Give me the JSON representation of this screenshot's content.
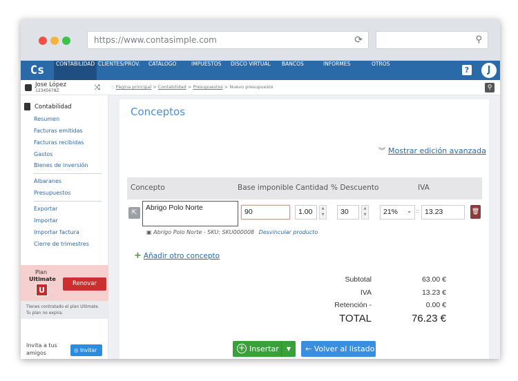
{
  "browser": {
    "url": "https://www.contasimple.com",
    "reload_icon": "reload-icon",
    "search_icon": "search-icon"
  },
  "nav": {
    "logo": "Cs",
    "items": [
      "CONTABILIDAD",
      "CLIENTES/PROV.",
      "CATÁLOGO",
      "IMPUESTOS",
      "DISCO VIRTUAL",
      "BANCOS",
      "INFORMES",
      "OTROS"
    ],
    "active": "CONTABILIDAD",
    "help": "?",
    "user_initial": "J",
    "accent": "#2b6aa8"
  },
  "user": {
    "name": "Jose López",
    "id": "12345678Z"
  },
  "breadcrumb": {
    "prefix": "::",
    "items": [
      "Página principal",
      "Contabilidad",
      "Presupuestos",
      "Nuevo presupuesto"
    ]
  },
  "sidebar": {
    "heading": "Contabilidad",
    "group1": [
      "Resumen",
      "Facturas emitidas",
      "Facturas recibidas",
      "Gastos",
      "Bienes de inversión"
    ],
    "group2": [
      "Albaranes",
      "Presupuestos"
    ],
    "group3": [
      "Exportar",
      "Importar",
      "Importar factura",
      "Cierre de trimestres"
    ],
    "plan": {
      "line1": "Plan",
      "line2": "Ultimate",
      "badge": "U",
      "renew": "Renovar",
      "info": "Tienes contratado el plan Ultimate. Tu plan no expira."
    },
    "invite_text": "Invita a tus amigos",
    "invite_button": "Invitar"
  },
  "main": {
    "title": "Conceptos",
    "advanced_link": "Mostrar edición avanzada",
    "columns": [
      "Concepto",
      "Base imponible",
      "Cantidad",
      "% Descuento",
      "IVA"
    ],
    "row": {
      "description": "Abrigo Polo Norte",
      "base": "90",
      "quantity": "1.00",
      "discount": "30",
      "iva_rate": "21%",
      "iva_amount": "13.23",
      "sku_text": "Abrigo Polo Norte - SKU: SKU000008",
      "unlink": "Desvincular producto"
    },
    "add_concept": "Añadir otro concepto",
    "totals": {
      "subtotal_label": "Subtotal",
      "subtotal": "63.00 €",
      "iva_label": "IVA",
      "iva": "13.23 €",
      "retencion_label": "Retención -",
      "retencion": "0.00 €",
      "total_label": "TOTAL",
      "total": "76.23 €"
    },
    "insert_button": "Insertar",
    "back_button": "Volver al listado"
  }
}
